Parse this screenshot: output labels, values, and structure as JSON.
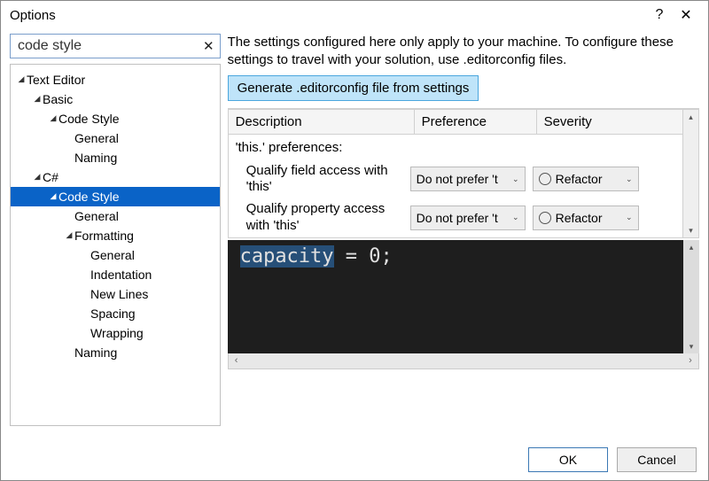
{
  "window": {
    "title": "Options",
    "help_icon": "?",
    "close_icon": "✕"
  },
  "search": {
    "value": "code style",
    "clear_icon": "✕"
  },
  "tree": [
    {
      "label": "Text Editor",
      "depth": 0,
      "expanded": true
    },
    {
      "label": "Basic",
      "depth": 1,
      "expanded": true
    },
    {
      "label": "Code Style",
      "depth": 2,
      "expanded": true
    },
    {
      "label": "General",
      "depth": 3
    },
    {
      "label": "Naming",
      "depth": 3
    },
    {
      "label": "C#",
      "depth": 1,
      "expanded": true
    },
    {
      "label": "Code Style",
      "depth": 2,
      "expanded": true,
      "selected": true
    },
    {
      "label": "General",
      "depth": 3
    },
    {
      "label": "Formatting",
      "depth": 3,
      "expanded": true
    },
    {
      "label": "General",
      "depth": 4
    },
    {
      "label": "Indentation",
      "depth": 4
    },
    {
      "label": "New Lines",
      "depth": 4
    },
    {
      "label": "Spacing",
      "depth": 4
    },
    {
      "label": "Wrapping",
      "depth": 4
    },
    {
      "label": "Naming",
      "depth": 3
    }
  ],
  "right": {
    "info": "The settings configured here only apply to your machine. To configure these settings to travel with your solution, use .editorconfig files.",
    "generate_btn": "Generate .editorconfig file from settings",
    "headers": {
      "description": "Description",
      "preference": "Preference",
      "severity": "Severity"
    },
    "group": "'this.' preferences:",
    "rows": [
      {
        "desc": "Qualify field access with 'this'",
        "pref": "Do not prefer 't",
        "sev": "Refactor"
      },
      {
        "desc": "Qualify property access with 'this'",
        "pref": "Do not prefer 't",
        "sev": "Refactor"
      }
    ],
    "caret": "⌄",
    "scroll_up": "▴",
    "scroll_down": "▾",
    "scroll_left": "‹",
    "scroll_right": "›"
  },
  "code": {
    "token_hl": "capacity",
    "rest": " = 0;"
  },
  "footer": {
    "ok": "OK",
    "cancel": "Cancel"
  }
}
